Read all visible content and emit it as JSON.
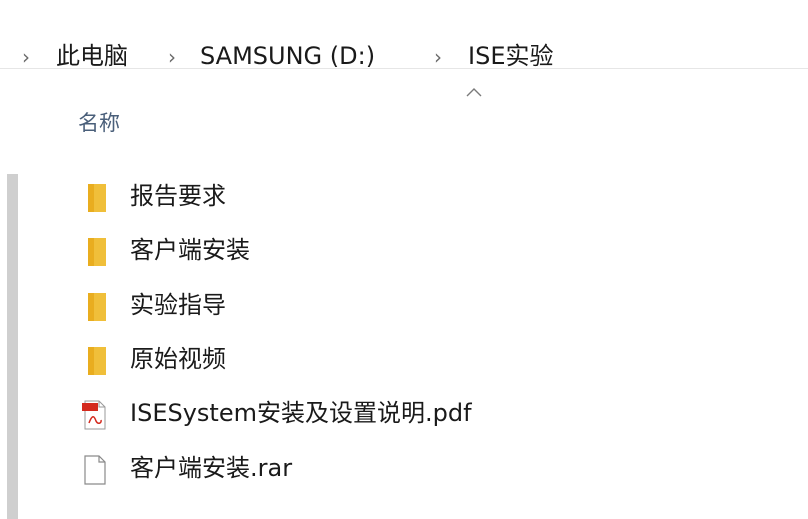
{
  "breadcrumb": {
    "separator": "›",
    "items": [
      "此电脑",
      "SAMSUNG (D:)",
      "ISE实验"
    ]
  },
  "column": {
    "name_header": "名称",
    "sort_indicator": "up"
  },
  "files": [
    {
      "name": "报告要求",
      "type": "folder"
    },
    {
      "name": "客户端安装",
      "type": "folder"
    },
    {
      "name": "实验指导",
      "type": "folder"
    },
    {
      "name": "原始视频",
      "type": "folder"
    },
    {
      "name": "ISESystem安装及设置说明.pdf",
      "type": "pdf"
    },
    {
      "name": "客户端安装.rar",
      "type": "file"
    }
  ],
  "colors": {
    "folder": "#f4c542",
    "folder_shadow": "#d9a520",
    "header_text": "#4a5f7a",
    "pdf_red": "#d42a1e"
  }
}
